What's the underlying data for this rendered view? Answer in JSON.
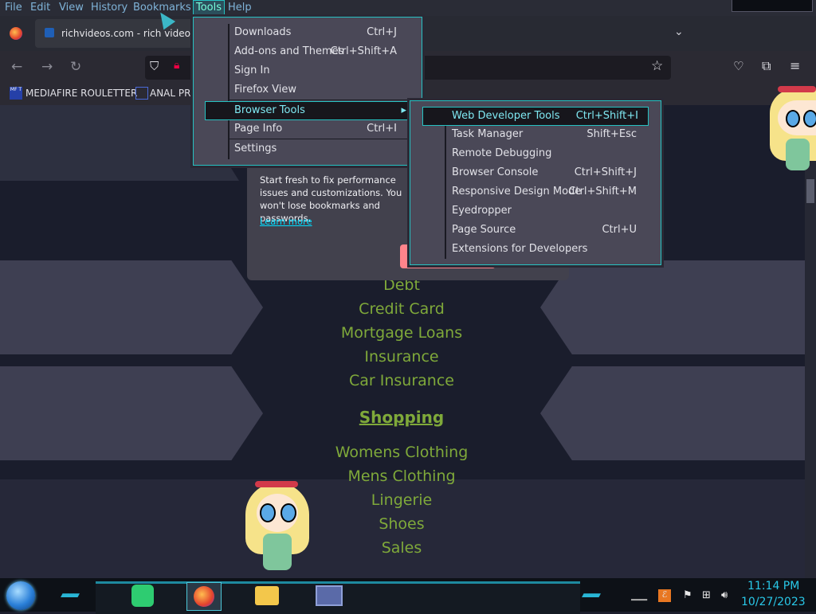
{
  "menubar": {
    "items": [
      "File",
      "Edit",
      "View",
      "History",
      "Bookmarks",
      "Tools",
      "Help"
    ],
    "active": "Tools"
  },
  "tab": {
    "title": "richvideos.com - rich videos Re"
  },
  "bookmarks": [
    {
      "icon": "mediafire-icon",
      "label": "MEDIAFIRE ROULETTER",
      "icon_text": "MF T"
    },
    {
      "icon": "bookmark-icon",
      "label": "ANAL PRO"
    }
  ],
  "tools_menu": {
    "items": [
      {
        "label": "Downloads",
        "shortcut": "Ctrl+J"
      },
      {
        "label": "Add-ons and Themes",
        "shortcut": "Ctrl+Shift+A"
      },
      {
        "label": "Sign In",
        "shortcut": ""
      },
      {
        "label": "Firefox View",
        "shortcut": ""
      },
      {
        "label": "Browser Tools",
        "shortcut": "",
        "submenu": true
      },
      {
        "label": "Page Info",
        "shortcut": "Ctrl+I"
      },
      {
        "label": "Settings",
        "shortcut": ""
      }
    ],
    "highlighted": "Browser Tools"
  },
  "browser_tools_menu": {
    "items": [
      {
        "label": "Web Developer Tools",
        "shortcut": "Ctrl+Shift+I"
      },
      {
        "label": "Task Manager",
        "shortcut": "Shift+Esc"
      },
      {
        "label": "Remote Debugging",
        "shortcut": ""
      },
      {
        "label": "Browser Console",
        "shortcut": "Ctrl+Shift+J"
      },
      {
        "label": "Responsive Design Mode",
        "shortcut": "Ctrl+Shift+M"
      },
      {
        "label": "Eyedropper",
        "shortcut": ""
      },
      {
        "label": "Page Source",
        "shortcut": "Ctrl+U"
      },
      {
        "label": "Extensions for Developers",
        "shortcut": ""
      }
    ],
    "highlighted": "Web Developer Tools"
  },
  "popup": {
    "text": "Start fresh to fix performance issues and customizations. You won't lose bookmarks and passwords.",
    "learn_more": "Learn more"
  },
  "page_links": {
    "finance": [
      "Debt",
      "Credit Card",
      "Mortgage Loans",
      "Insurance",
      "Car Insurance"
    ],
    "shopping_heading": "Shopping",
    "shopping": [
      "Womens Clothing",
      "Mens Clothing",
      "Lingerie",
      "Shoes",
      "Sales"
    ]
  },
  "taskbar": {
    "apps": [
      "notes-app-icon",
      "firefox-icon",
      "file-explorer-icon",
      "window-app-icon"
    ],
    "active_app": "firefox-icon",
    "time": "11:14 PM",
    "date": "10/27/2023"
  },
  "colors": {
    "menu_highlight_border": "#26c2c2",
    "link_green": "#7fa93a",
    "clock": "#29c8e8"
  }
}
